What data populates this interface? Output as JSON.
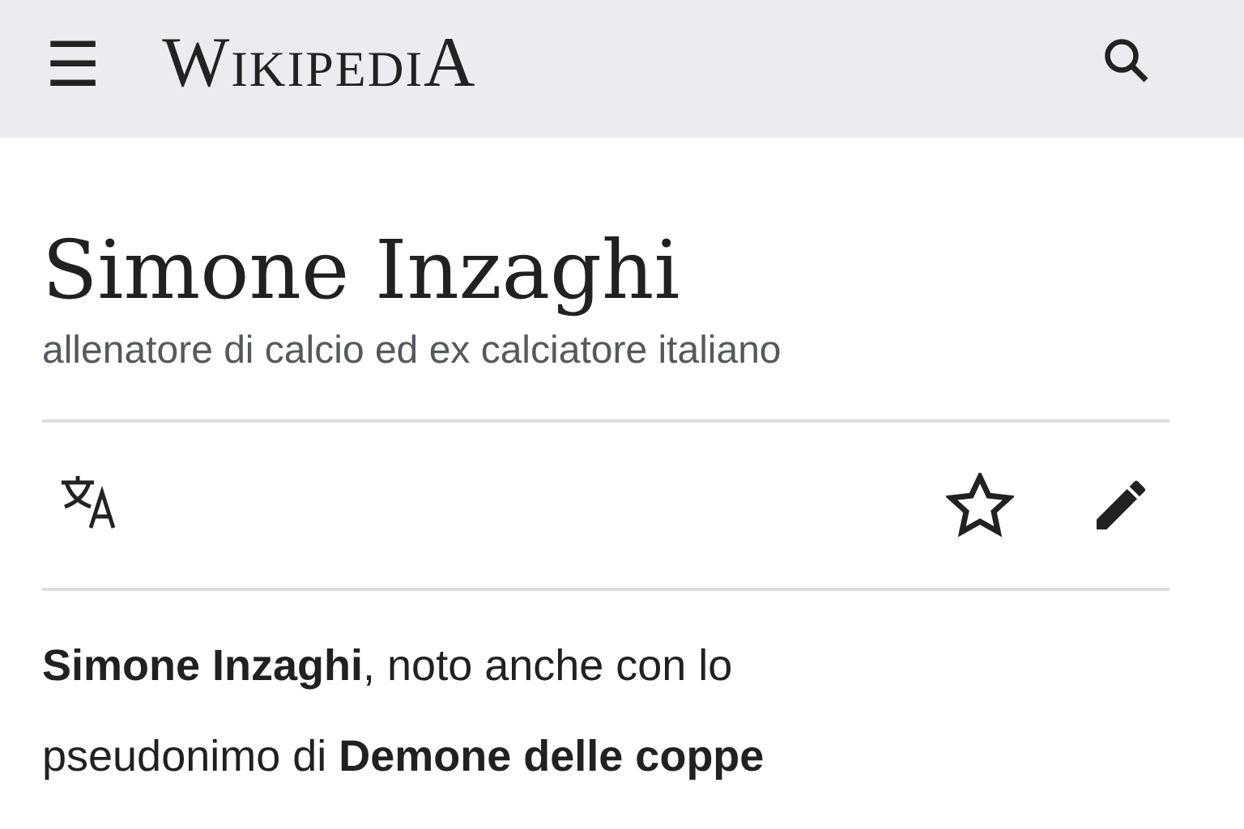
{
  "header": {
    "menu_icon": "☰",
    "logo": "WikipediA"
  },
  "article": {
    "title": "Simone Inzaghi",
    "description": "allenatore di calcio ed ex calciatore italiano",
    "actions": [
      {
        "kind": "language"
      },
      {
        "kind": "watch",
        "selected": false
      },
      {
        "kind": "edit"
      }
    ],
    "lead": "**Simone Inzaghi**, noto anche con lo pseudonimo di **Demone delle coppe**"
  }
}
